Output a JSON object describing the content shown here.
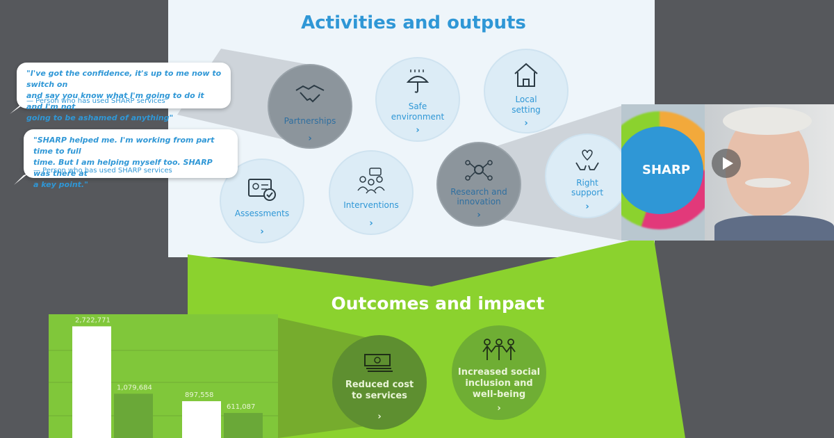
{
  "activities": {
    "title": "Activities and outputs",
    "items": [
      {
        "label_lines": [
          "Partnerships"
        ],
        "icon": "handshake-icon",
        "chevron": "›"
      },
      {
        "label_lines": [
          "Safe",
          "environment"
        ],
        "icon": "umbrella-rain-icon",
        "chevron": "›"
      },
      {
        "label_lines": [
          "Local",
          "setting"
        ],
        "icon": "house-icon",
        "chevron": "›"
      },
      {
        "label_lines": [
          "Assessments"
        ],
        "icon": "id-card-check-icon",
        "chevron": "›"
      },
      {
        "label_lines": [
          "Interventions"
        ],
        "icon": "group-chat-icon",
        "chevron": "›"
      },
      {
        "label_lines": [
          "Research and",
          "innovation"
        ],
        "icon": "network-lightbulb-icon",
        "chevron": "›"
      },
      {
        "label_lines": [
          "Right",
          "support"
        ],
        "icon": "hands-heart-icon",
        "chevron": "›"
      }
    ]
  },
  "outcomes": {
    "title": "Outcomes and impact",
    "items": [
      {
        "label_lines": [
          "Reduced cost",
          "to services"
        ],
        "icon": "money-stack-icon",
        "chevron": "›"
      },
      {
        "label_lines": [
          "Increased social",
          "inclusion and",
          "well-being"
        ],
        "icon": "people-chain-icon",
        "chevron": "›"
      }
    ]
  },
  "quotes": [
    {
      "lines": [
        "\"I've got the confidence, it's up to me now to switch on",
        "and say you know what I'm going to do it and I'm not",
        "going to be ashamed of anything\""
      ],
      "attribution": "— Person who has used SHARP services"
    },
    {
      "lines": [
        "\"SHARP helped me. I'm working from part time to full",
        "time. But I am helping myself too. SHARP was there at",
        "a key point.\""
      ],
      "attribution": "— Person who has used SHARP services"
    }
  ],
  "video": {
    "logo_text": "SHARP",
    "play_icon": "play-icon"
  },
  "colors": {
    "blue": "#2f97d6",
    "green": "#8bd22e",
    "dark_green": "#78b23a",
    "grey_bg": "#56585c"
  },
  "chart_data": {
    "type": "bar",
    "categories": [
      "",
      ""
    ],
    "series": [
      {
        "values": [
          2722771,
          897558
        ]
      },
      {
        "values": [
          1079684,
          611087
        ]
      }
    ],
    "data_labels": [
      [
        "2,722,771",
        "897,558"
      ],
      [
        "1,079,684",
        "611,087"
      ]
    ],
    "ylim": [
      0,
      3000000
    ],
    "grid": true
  }
}
